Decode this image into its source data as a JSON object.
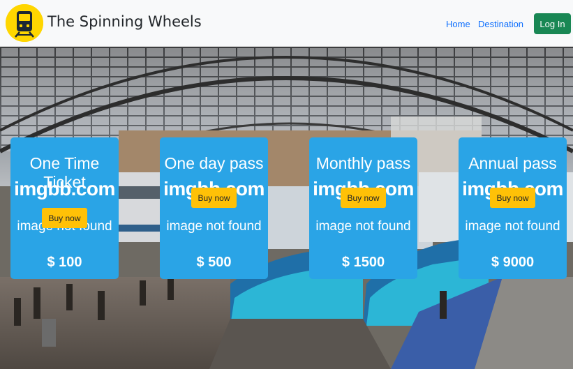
{
  "navbar": {
    "brand": "The Spinning Wheels",
    "logo_icon": "train-icon",
    "links": [
      "Home",
      "Destination"
    ],
    "login_label": "Log In"
  },
  "colors": {
    "card_bg": "#2aa4e6",
    "buy_button": "#ffc107",
    "login_button": "#198754",
    "nav_link": "#0d6efd",
    "logo_circle": "#ffd600"
  },
  "broken_image": {
    "line1": "imgbb.com",
    "line2": "image not found"
  },
  "cards": [
    {
      "title": "One Time Ticket",
      "button": "Buy now",
      "price": "$ 100"
    },
    {
      "title": "One day pass",
      "button": "Buy now",
      "price": "$ 500"
    },
    {
      "title": "Monthly pass",
      "button": "Buy now",
      "price": "$ 1500"
    },
    {
      "title": "Annual pass",
      "button": "Buy now",
      "price": "$ 9000"
    }
  ]
}
